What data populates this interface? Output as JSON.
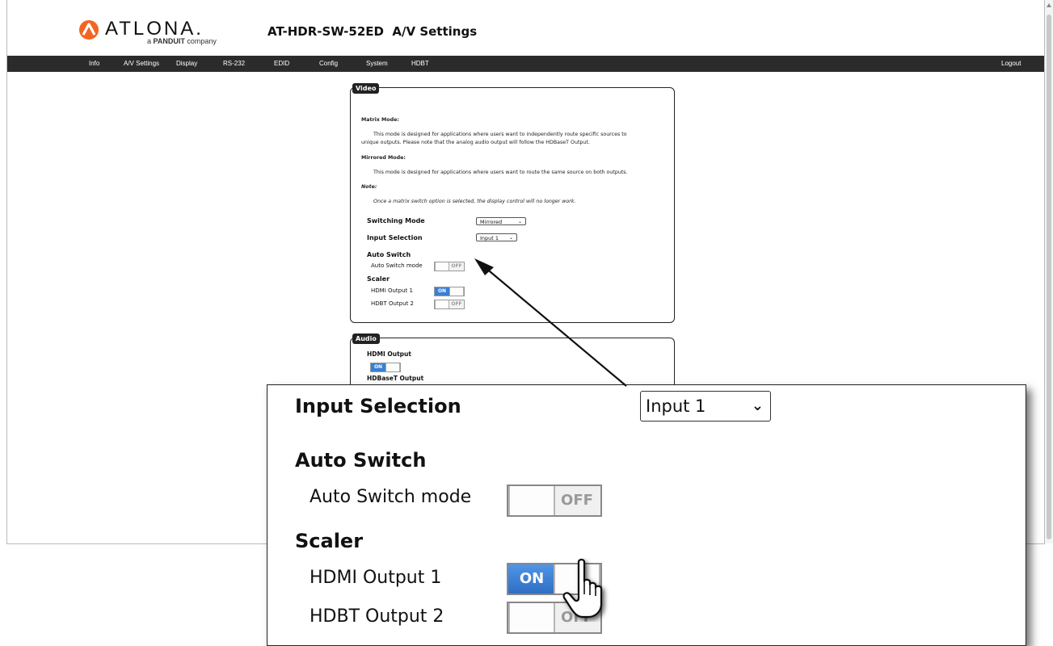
{
  "header": {
    "logo_word": "ATLONA.",
    "logo_sub_prefix": "a ",
    "logo_sub_brand": "PANDUIT",
    "logo_sub_suffix": " company",
    "page_title": "AT-HDR-SW-52ED  A/V Settings",
    "brand_color": "#f26522"
  },
  "nav": {
    "items": [
      "Info",
      "A/V Settings",
      "Display",
      "RS-232",
      "EDID",
      "Config",
      "System",
      "HDBT"
    ],
    "logout": "Logout"
  },
  "video": {
    "legend": "Video",
    "matrix_title": "Matrix Mode:",
    "matrix_desc_1": "This mode is designed for applications where users want to independently route specific sources to",
    "matrix_desc_2": "unique outputs. Please note that the analog audio output will follow the HDBaseT Output.",
    "mirrored_title": "Mirrored Mode:",
    "mirrored_desc": "This mode is designed for applications where users want to route the same source on both outputs.",
    "note_title": "Note:",
    "note_desc": "Once a matrix switch option is selected, the display control will no longer work.",
    "switching_mode_label": "Switching Mode",
    "switching_mode_value": "Mirrored",
    "input_selection_label": "Input Selection",
    "input_selection_value": "Input 1",
    "auto_switch_label": "Auto Switch",
    "auto_switch_mode_label": "Auto Switch mode",
    "auto_switch_state": "OFF",
    "scaler_label": "Scaler",
    "hdmi_output_1_label": "HDMI Output 1",
    "hdmi_output_1_state": "ON",
    "hdbt_output_2_label": "HDBT Output 2",
    "hdbt_output_2_state": "OFF"
  },
  "audio": {
    "legend": "Audio",
    "hdmi_output_label": "HDMI Output",
    "hdmi_output_state": "ON",
    "hdbaset_output_label": "HDBaseT Output"
  },
  "zoom": {
    "input_selection_label": "Input Selection",
    "input_selection_value": "Input 1",
    "auto_switch_label": "Auto Switch",
    "auto_switch_mode_label": "Auto Switch mode",
    "auto_switch_state": "OFF",
    "scaler_label": "Scaler",
    "hdmi_output_1_label": "HDMI Output 1",
    "hdmi_output_1_state": "ON",
    "hdbt_output_2_label": "HDBT Output 2",
    "hdbt_output_2_state": "OFF"
  },
  "colors": {
    "navbar": "#2b2b2b",
    "toggle_on": "#3a7fd2"
  }
}
